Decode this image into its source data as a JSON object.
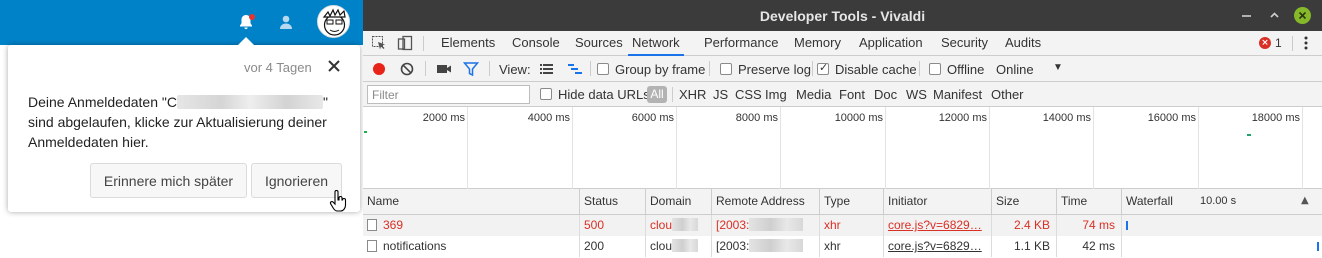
{
  "notification": {
    "time": "vor 4 Tagen",
    "message_part1": "Deine Anmeldedaten \"C",
    "message_part2": "\" sind abgelaufen, klicke zur Aktualisierung deiner Anmeldedaten hier.",
    "remind_label": "Erinnere mich später",
    "ignore_label": "Ignorieren"
  },
  "colors": {
    "header_blue": "#0082c9",
    "error_red": "#d93025",
    "tab_accent": "#1a73e8",
    "window_close_green": "#86b92a"
  },
  "devtools": {
    "title": "Developer Tools - Vivaldi",
    "tabs": [
      {
        "label": "Elements"
      },
      {
        "label": "Console"
      },
      {
        "label": "Sources"
      },
      {
        "label": "Network"
      },
      {
        "label": "Performance"
      },
      {
        "label": "Memory"
      },
      {
        "label": "Application"
      },
      {
        "label": "Security"
      },
      {
        "label": "Audits"
      }
    ],
    "active_tab": "Network",
    "error_count": "1",
    "toolbar": {
      "view_label": "View:",
      "group_by_frame": "Group by frame",
      "preserve_log": "Preserve log",
      "disable_cache": "Disable cache",
      "offline": "Offline",
      "throttle_value": "Online"
    },
    "filter": {
      "placeholder": "Filter",
      "hide_data_urls": "Hide data URLs",
      "types": [
        "All",
        "XHR",
        "JS",
        "CSS",
        "Img",
        "Media",
        "Font",
        "Doc",
        "WS",
        "Manifest",
        "Other"
      ]
    },
    "overview_ticks": [
      "2000 ms",
      "4000 ms",
      "6000 ms",
      "8000 ms",
      "10000 ms",
      "12000 ms",
      "14000 ms",
      "16000 ms",
      "18000 ms"
    ],
    "columns": {
      "name": "Name",
      "status": "Status",
      "domain": "Domain",
      "remote": "Remote Address",
      "type": "Type",
      "initiator": "Initiator",
      "size": "Size",
      "time": "Time",
      "waterfall": "Waterfall",
      "waterfall_scale": "10.00 s"
    },
    "rows": [
      {
        "name": "369",
        "status": "500",
        "domain": "clou",
        "remote": "[2003:",
        "type": "xhr",
        "initiator": "core.js?v=6829…",
        "size": "2.4 KB",
        "time": "74 ms",
        "error": true
      },
      {
        "name": "notifications",
        "status": "200",
        "domain": "clou",
        "remote": "[2003:",
        "type": "xhr",
        "initiator": "core.js?v=6829…",
        "size": "1.1 KB",
        "time": "42 ms",
        "error": false
      }
    ]
  }
}
